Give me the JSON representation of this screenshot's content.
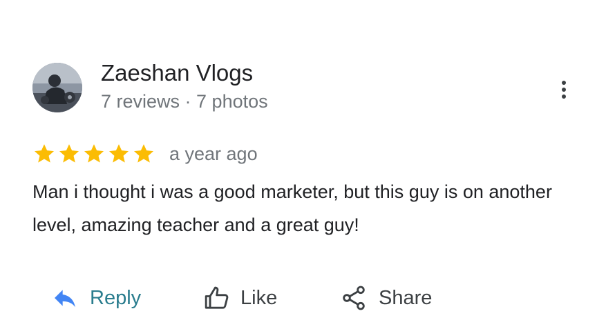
{
  "review": {
    "author": {
      "name": "Zaeshan Vlogs",
      "meta": "7 reviews · 7 photos",
      "avatar": "user-avatar-photo"
    },
    "rating": {
      "value": 5,
      "max": 5,
      "star_color": "#fbbc04"
    },
    "date": "a year ago",
    "text": "Man i thought i was a good marketer, but this guy is on another level, amazing teacher and a great guy!",
    "more_icon": "more-vert-icon"
  },
  "actions": {
    "reply": {
      "label": "Reply",
      "icon": "reply-arrow-icon",
      "color": "#1a73e8"
    },
    "like": {
      "label": "Like",
      "icon": "thumb-up-icon"
    },
    "share": {
      "label": "Share",
      "icon": "share-icon"
    }
  }
}
